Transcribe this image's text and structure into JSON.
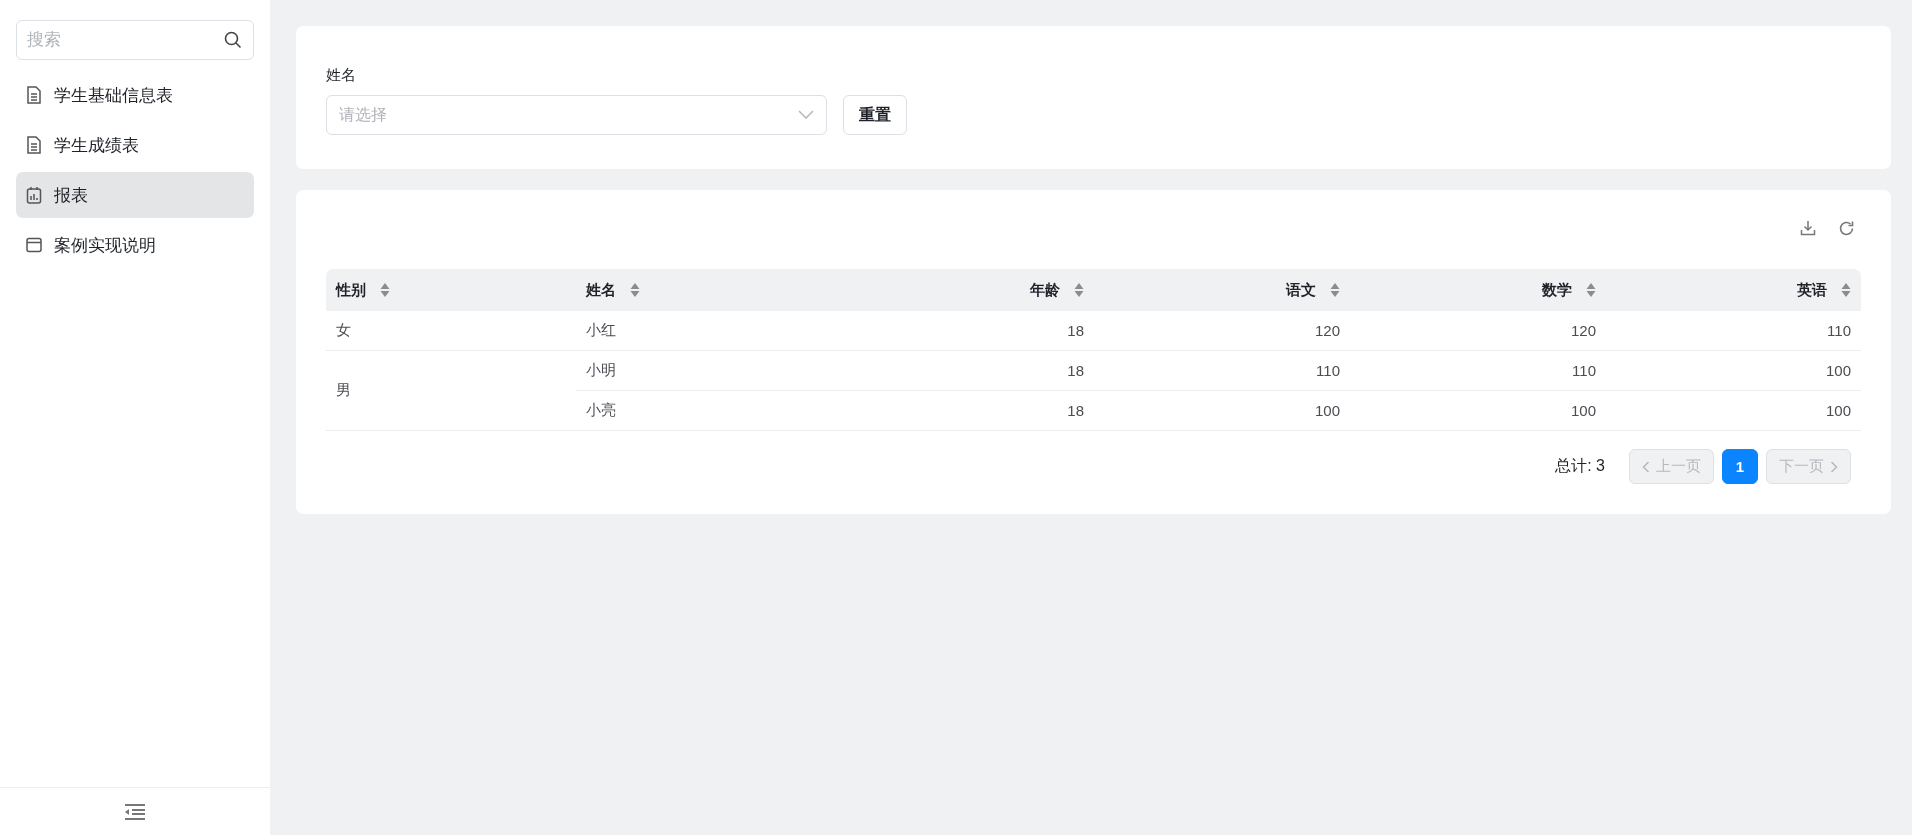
{
  "sidebar": {
    "search": {
      "placeholder": "搜索"
    },
    "items": [
      {
        "label": "学生基础信息表",
        "kind": "document",
        "selected": false
      },
      {
        "label": "学生成绩表",
        "kind": "document",
        "selected": false
      },
      {
        "label": "报表",
        "kind": "report",
        "selected": true
      },
      {
        "label": "案例实现说明",
        "kind": "page",
        "selected": false
      }
    ]
  },
  "filter": {
    "label": "姓名",
    "select": {
      "placeholder": "请选择"
    },
    "reset_button": "重置"
  },
  "table": {
    "columns": [
      "性别",
      "姓名",
      "年龄",
      "语文",
      "数学",
      "英语"
    ],
    "groups": [
      {
        "gender": "女",
        "rows": [
          [
            "小红",
            "18",
            "120",
            "120",
            "110"
          ]
        ]
      },
      {
        "gender": "男",
        "rows": [
          [
            "小明",
            "18",
            "110",
            "110",
            "100"
          ],
          [
            "小亮",
            "18",
            "100",
            "100",
            "100"
          ]
        ]
      }
    ]
  },
  "pagination": {
    "total": "总计: 3",
    "prev": {
      "label": "上一页",
      "disabled": true
    },
    "pages": [
      {
        "label": "1",
        "selected": true
      }
    ],
    "next": {
      "label": "下一页",
      "disabled": true
    }
  }
}
